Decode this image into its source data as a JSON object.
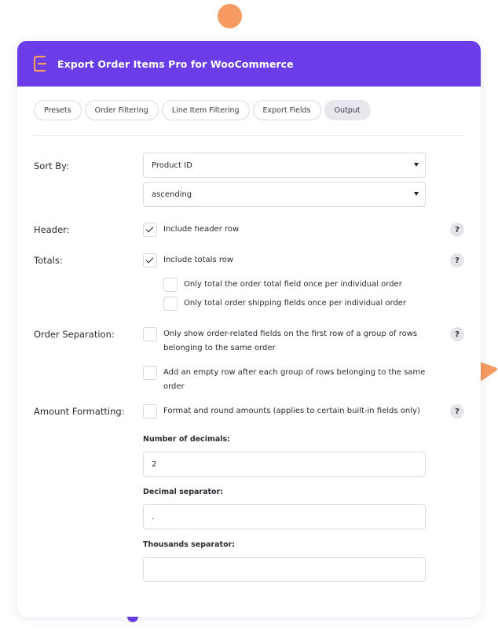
{
  "app": {
    "title": "Export Order Items Pro for WooCommerce"
  },
  "tabs": [
    {
      "label": "Presets"
    },
    {
      "label": "Order Filtering"
    },
    {
      "label": "Line Item Filtering"
    },
    {
      "label": "Export Fields"
    },
    {
      "label": "Output",
      "active": true
    }
  ],
  "sort": {
    "label": "Sort By:",
    "field_value": "Product ID",
    "direction_value": "ascending"
  },
  "header_section": {
    "label": "Header:",
    "include_header_row": {
      "label": "Include header row",
      "checked": true
    }
  },
  "totals": {
    "label": "Totals:",
    "include_totals_row": {
      "label": "Include totals row",
      "checked": true
    },
    "once_per_order": {
      "label": "Only total the order total field once per individual order",
      "checked": false
    },
    "shipping_once": {
      "label": "Only total order shipping fields once per individual order",
      "checked": false
    }
  },
  "order_separation": {
    "label": "Order Separation:",
    "first_row_only": {
      "label": "Only show order-related fields on the first row of a group of rows belonging to the same order",
      "checked": false
    },
    "empty_row_after": {
      "label": "Add an empty row after each group of rows belonging to the same order",
      "checked": false
    }
  },
  "amount_formatting": {
    "label": "Amount Formatting:",
    "format_round": {
      "label": "Format and round amounts (applies to certain built-in fields only)",
      "checked": false
    },
    "decimals": {
      "label": "Number of decimals:",
      "value": "2"
    },
    "decimal_separator": {
      "label": "Decimal separator:",
      "value": "."
    },
    "thousands_separator": {
      "label": "Thousands separator:",
      "value": ""
    }
  },
  "help_symbol": "?",
  "colors": {
    "brand": "#6a3de8",
    "accent": "#f79a62"
  }
}
